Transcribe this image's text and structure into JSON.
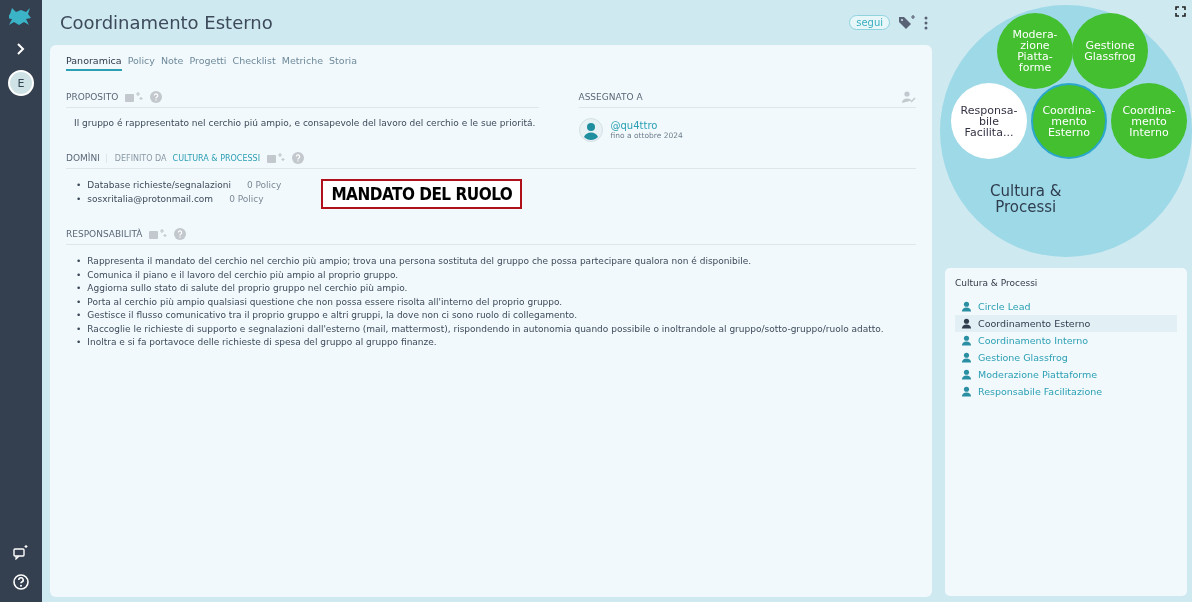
{
  "sidebar": {
    "avatar": "E"
  },
  "header": {
    "title": "Coordinamento Esterno",
    "follow": "segui"
  },
  "tabs": [
    {
      "label": "Panoramica",
      "selected": true
    },
    {
      "label": "Policy",
      "selected": false
    },
    {
      "label": "Note",
      "selected": false
    },
    {
      "label": "Progetti",
      "selected": false
    },
    {
      "label": "Checklist",
      "selected": false
    },
    {
      "label": "Metriche",
      "selected": false
    },
    {
      "label": "Storia",
      "selected": false
    }
  ],
  "purpose": {
    "heading": "PROPOSITO",
    "text": "Il gruppo é rappresentato nel cerchio piú ampio, e consapevole del lavoro del cerchio e le sue prioritá."
  },
  "assigned": {
    "heading": "ASSEGNATO A",
    "user": "@qu4ttro",
    "until": "fino a ottobre 2024"
  },
  "domains": {
    "heading": "DOMÌNI",
    "defined_by": "DEFINITO DA",
    "circle": "CULTURA & PROCESSI",
    "items": [
      {
        "name": "Database richieste/segnalazioni",
        "policy": "0 Policy"
      },
      {
        "name": "sosxritalia@protonmail.com",
        "policy": "0 Policy"
      }
    ]
  },
  "bullet": "•",
  "annotation": "MANDATO DEL RUOLO",
  "responsibilities": {
    "heading": "RESPONSABILITÀ",
    "items": [
      "Rappresenta il mandato del cerchio nel cerchio più ampio; trova una persona sostituta del gruppo che possa partecipare qualora non é disponibile.",
      "Comunica il piano e il lavoro del cerchio più ampio al proprio gruppo.",
      "Aggiorna sullo stato di salute del proprio gruppo nel cerchio più ampio.",
      "Porta al cerchio più ampio qualsiasi questione che non possa essere risolta all'interno del proprio gruppo.",
      "Gestisce il flusso comunicativo tra il proprio gruppo e altri gruppi, la dove non ci sono ruolo di collegamento.",
      "Raccoglie le richieste di supporto e segnalazioni dall'esterno (mail, mattermost), rispondendo in autonomia quando possibile o inoltrandole al gruppo/sotto-gruppo/ruolo adatto.",
      "Inoltra e si fa portavoce delle richieste di spesa del gruppo al gruppo finanze."
    ]
  },
  "circle_map": {
    "label": "Cultura & Processi",
    "roles": [
      {
        "name": "Modera-\nzione\nPiatta-\nforme",
        "color": "#43bf2f",
        "selected": false
      },
      {
        "name": "Gestione\nGlassfrog",
        "color": "#43bf2f",
        "selected": false
      },
      {
        "name": "Responsa-\nbile\nFacilita...",
        "color": "#ffffff",
        "selected": false
      },
      {
        "name": "Coordina-\nmento\nEsterno",
        "color": "#43bf2f",
        "selected": true
      },
      {
        "name": "Coordina-\nmento\nInterno",
        "color": "#43bf2f",
        "selected": false
      }
    ]
  },
  "role_list": {
    "title": "Cultura & Processi",
    "items": [
      {
        "label": "Circle Lead",
        "selected": false
      },
      {
        "label": "Coordinamento Esterno",
        "selected": true
      },
      {
        "label": "Coordinamento Interno",
        "selected": false
      },
      {
        "label": "Gestione Glassfrog",
        "selected": false
      },
      {
        "label": "Moderazione Piattaforme",
        "selected": false
      },
      {
        "label": "Responsabile Facilitazione",
        "selected": false
      }
    ]
  }
}
